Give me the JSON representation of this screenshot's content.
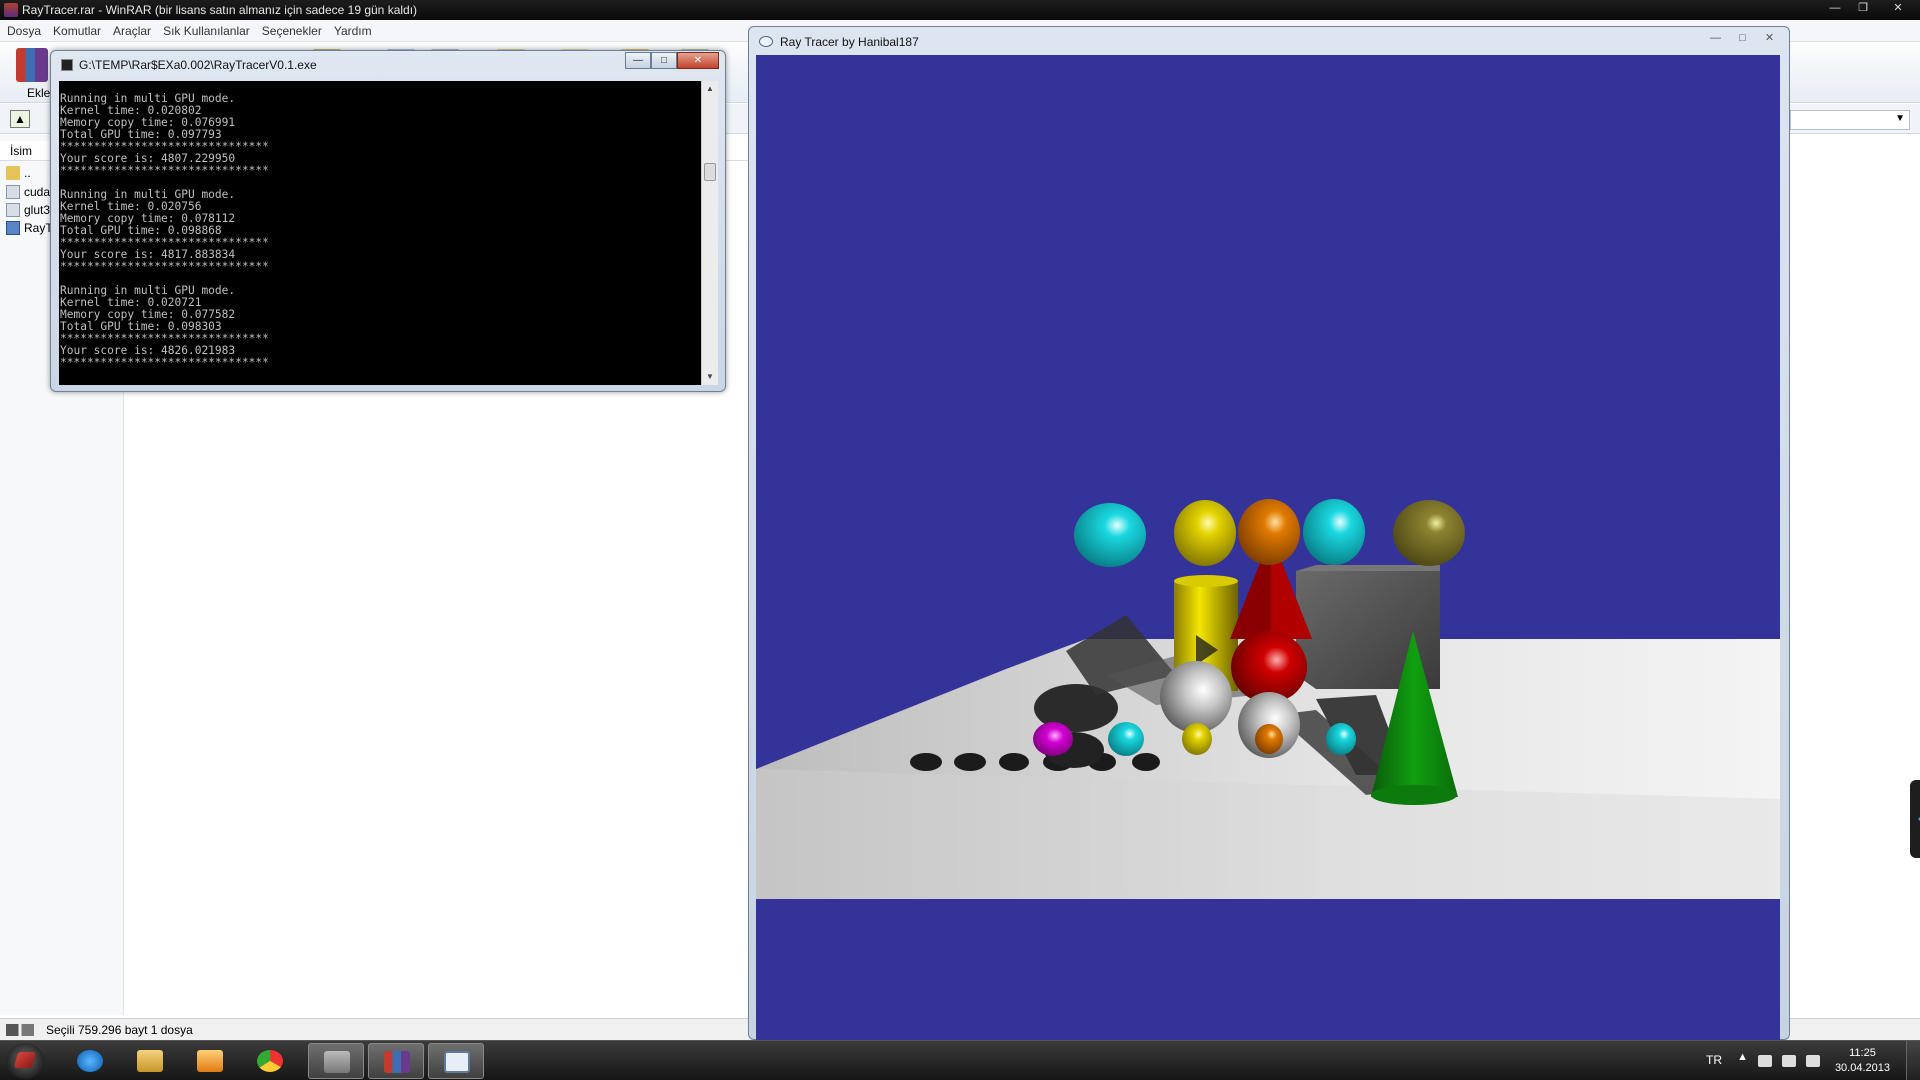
{
  "winrar": {
    "title": "RayTracer.rar - WinRAR (bir lisans satın almanız için sadece 19 gün kaldı)",
    "menu": [
      "Dosya",
      "Komutlar",
      "Araçlar",
      "Sık Kullanılanlar",
      "Seçenekler",
      "Yardım"
    ],
    "toolbar": {
      "add_label": "Ekle"
    },
    "columns": {
      "name": "İsim"
    },
    "files": [
      {
        "name": "..",
        "icon": "folder-icon"
      },
      {
        "name": "cuda",
        "icon": "dll-icon"
      },
      {
        "name": "glut3",
        "icon": "dll-icon"
      },
      {
        "name": "RayT",
        "icon": "exe-icon"
      }
    ],
    "status": "Seçili 759.296 bayt 1 dosya"
  },
  "console": {
    "title": "G:\\TEMP\\Rar$EXa0.002\\RayTracerV0.1.exe",
    "output": "Running in multi GPU mode.\nKernel time: 0.020802\nMemory copy time: 0.076991\nTotal GPU time: 0.097793\n*******************************\nYour score is: 4807.229950\n*******************************\n\nRunning in multi GPU mode.\nKernel time: 0.020756\nMemory copy time: 0.078112\nTotal GPU time: 0.098868\n*******************************\nYour score is: 4817.883834\n*******************************\n\nRunning in multi GPU mode.\nKernel time: 0.020721\nMemory copy time: 0.077582\nTotal GPU time: 0.098303\n*******************************\nYour score is: 4826.021983\n*******************************"
  },
  "raytracer": {
    "title": "Ray Tracer by Hanibal187",
    "background_color": "#333399"
  },
  "taskbar": {
    "apps": [
      "internet-explorer-icon",
      "file-explorer-icon",
      "media-player-icon",
      "chrome-icon",
      "winrar-sfx-icon",
      "winrar-icon",
      "raytracer-icon"
    ],
    "language": "TR",
    "time": "11:25",
    "date": "30.04.2013"
  }
}
